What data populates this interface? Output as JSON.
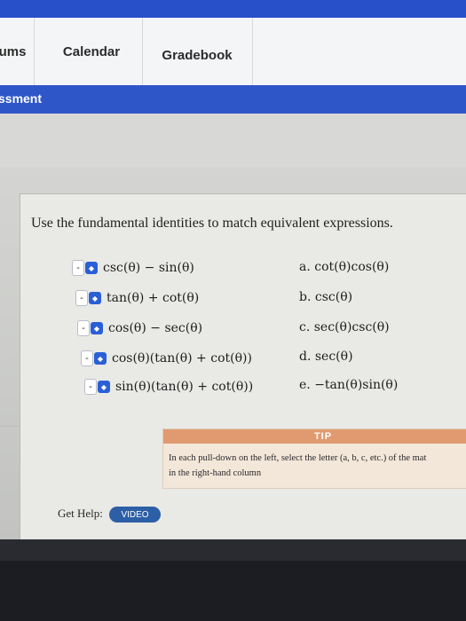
{
  "nav": {
    "tabs": [
      {
        "label": "ums"
      },
      {
        "label": "Calendar"
      },
      {
        "label": "Gradebook"
      }
    ]
  },
  "assessment_bar": {
    "label": "ssment"
  },
  "question": {
    "instruction": "Use the fundamental identities to match equivalent expressions.",
    "left_items": [
      {
        "dropdown_value": "-",
        "expression": "csc(θ) − sin(θ)"
      },
      {
        "dropdown_value": "-",
        "expression": "tan(θ) + cot(θ)"
      },
      {
        "dropdown_value": "-",
        "expression": "cos(θ) − sec(θ)"
      },
      {
        "dropdown_value": "-",
        "expression": "cos(θ)(tan(θ) + cot(θ))"
      },
      {
        "dropdown_value": "-",
        "expression": "sin(θ)(tan(θ) + cot(θ))"
      }
    ],
    "right_items": [
      {
        "letter": "a.",
        "expression": "cot(θ)cos(θ)"
      },
      {
        "letter": "b.",
        "expression": "csc(θ)"
      },
      {
        "letter": "c.",
        "expression": "sec(θ)csc(θ)"
      },
      {
        "letter": "d.",
        "expression": "sec(θ)"
      },
      {
        "letter": "e.",
        "expression": "−tan(θ)sin(θ)"
      }
    ]
  },
  "tip": {
    "heading": "TIP",
    "line1": "In each pull-down on the left, select the letter (a, b, c, etc.) of the mat",
    "line2": "in the right-hand column"
  },
  "help": {
    "label": "Get Help:",
    "video_label": "VIDEO"
  },
  "icons": {
    "dropdown_arrow": "chevron-updown-icon"
  },
  "colors": {
    "nav_accent": "#2f56c8",
    "tip_header": "#e19a6f",
    "video_button": "#2d5fa6"
  }
}
